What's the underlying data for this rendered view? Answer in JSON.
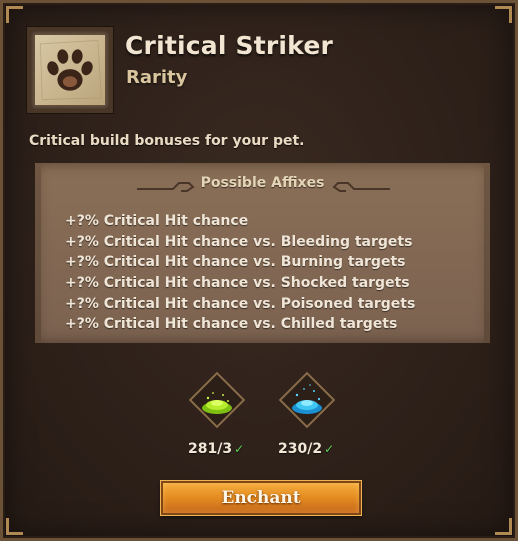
{
  "header": {
    "title": "Critical Striker",
    "subtitle": "Rarity",
    "icon": "paw-print-icon"
  },
  "description": "Critical build bonuses for your pet.",
  "affixes": {
    "header": "Possible Affixes",
    "items": [
      "+?% Critical Hit chance",
      "+?% Critical Hit chance vs. Bleeding targets",
      "+?% Critical Hit chance vs. Burning targets",
      "+?% Critical Hit chance vs. Shocked targets",
      "+?% Critical Hit chance vs. Poisoned targets",
      "+?% Critical Hit chance vs. Chilled targets"
    ]
  },
  "materials": [
    {
      "icon": "green-dust-icon",
      "count": "281/3",
      "color": "#a6e21f"
    },
    {
      "icon": "blue-dust-icon",
      "count": "230/2",
      "color": "#3fc6f2"
    }
  ],
  "check_mark": "✓",
  "enchant_button": "Enchant",
  "colors": {
    "button": "#e58e22",
    "check": "#5fd15b",
    "panel_border": "#6b5136"
  }
}
